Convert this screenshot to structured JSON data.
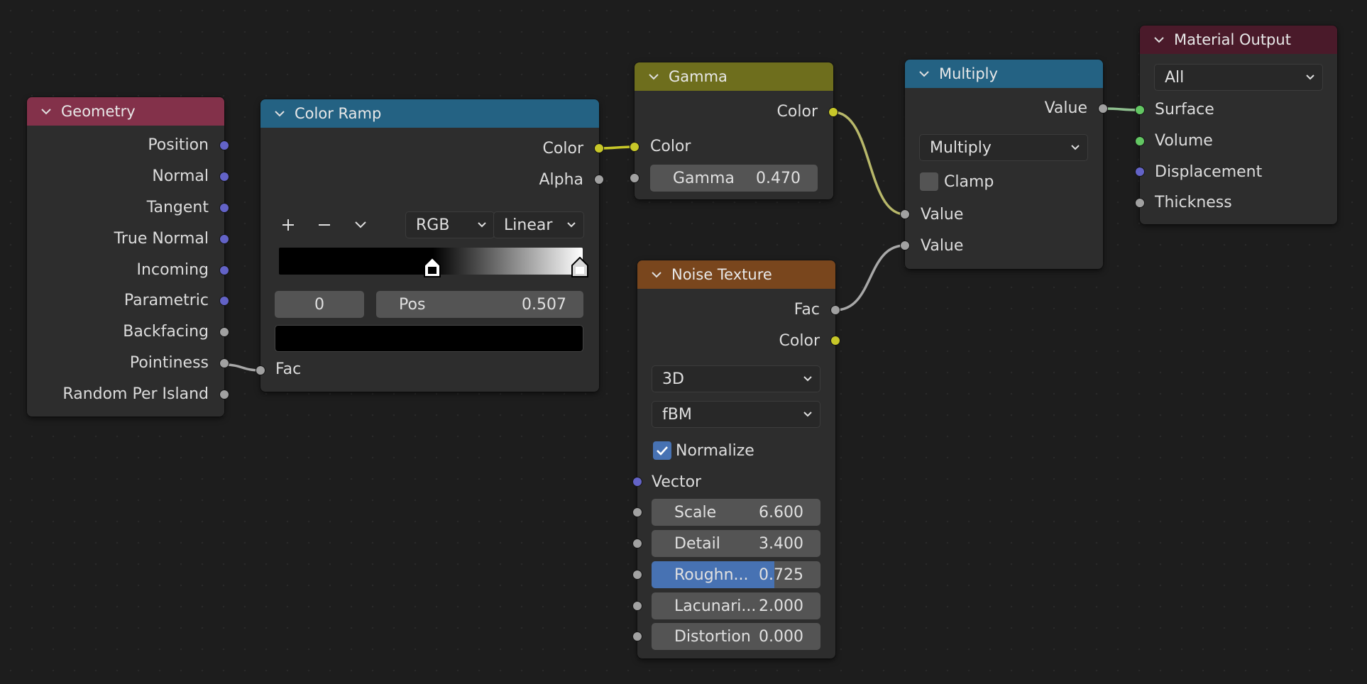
{
  "colors": {
    "background": "#1d1d1d",
    "node_body": "#2d2d2d",
    "header_input": "#83314a",
    "header_converter": "#246283",
    "header_color": "#6e6e1d",
    "header_texture": "#79461d",
    "header_output": "#4a1a2a",
    "socket_vector": "#6363c7",
    "socket_float": "#a1a1a1",
    "socket_color": "#c7c729",
    "socket_shader": "#63c763",
    "slider_fill": "#4772b3"
  },
  "geometry": {
    "title": "Geometry",
    "outputs": [
      "Position",
      "Normal",
      "Tangent",
      "True Normal",
      "Incoming",
      "Parametric",
      "Backfacing",
      "Pointiness",
      "Random Per Island"
    ]
  },
  "color_ramp": {
    "title": "Color Ramp",
    "out_color": "Color",
    "out_alpha": "Alpha",
    "add_icon": "plus-icon",
    "remove_icon": "minus-icon",
    "menu_icon": "chevron-down-icon",
    "color_mode": "RGB",
    "interpolation": "Linear",
    "stop_index": "0",
    "pos_label": "Pos",
    "pos_value": "0.507",
    "in_fac": "Fac"
  },
  "gamma": {
    "title": "Gamma",
    "out_color": "Color",
    "in_color": "Color",
    "gamma_label": "Gamma",
    "gamma_value": "0.470"
  },
  "noise": {
    "title": "Noise Texture",
    "out_fac": "Fac",
    "out_color": "Color",
    "dimensions": "3D",
    "noise_type": "fBM",
    "normalize_label": "Normalize",
    "normalize_checked": true,
    "vector_label": "Vector",
    "fields": [
      {
        "label": "Scale",
        "value": "6.600"
      },
      {
        "label": "Detail",
        "value": "3.400"
      },
      {
        "label": "Roughn...",
        "value": "0.725",
        "fraction": 0.725
      },
      {
        "label": "Lacunari...",
        "value": "2.000"
      },
      {
        "label": "Distortion",
        "value": "0.000"
      }
    ]
  },
  "multiply": {
    "title": "Multiply",
    "out_value": "Value",
    "operation": "Multiply",
    "clamp_label": "Clamp",
    "clamp_checked": false,
    "in_value_1": "Value",
    "in_value_2": "Value"
  },
  "material_output": {
    "title": "Material Output",
    "target": "All",
    "inputs": [
      "Surface",
      "Volume",
      "Displacement",
      "Thickness"
    ]
  }
}
